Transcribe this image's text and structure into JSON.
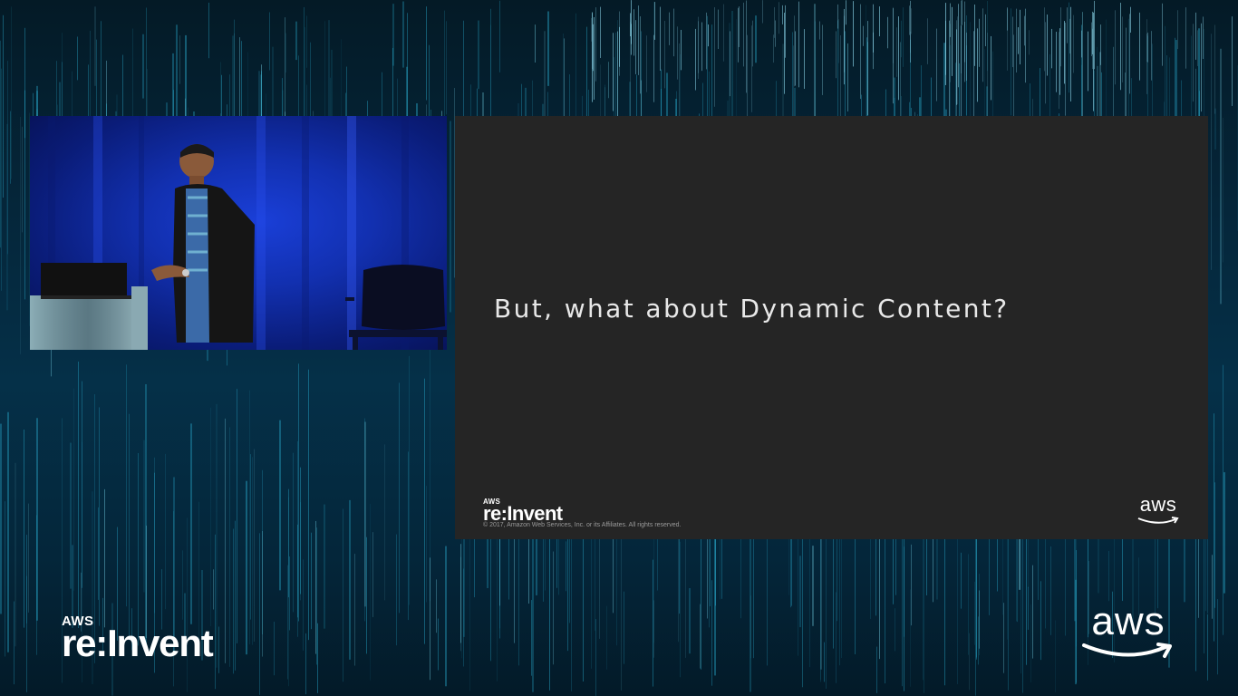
{
  "slide": {
    "heading": "But, what about Dynamic Content?",
    "logo_small": "AWS",
    "logo_big": "re:Invent",
    "copyright": "© 2017, Amazon Web Services, Inc. or its Affiliates. All rights reserved.",
    "aws_logo": "aws"
  },
  "event_logo": {
    "small": "AWS",
    "big": "re:Invent"
  },
  "aws_logo": "aws",
  "colors": {
    "slide_background": "#252525",
    "stage_background": "#04263a",
    "streak": "#2bb3d6",
    "video_backdrop": "#1230b0"
  },
  "icons": [
    "aws-smile-icon"
  ]
}
